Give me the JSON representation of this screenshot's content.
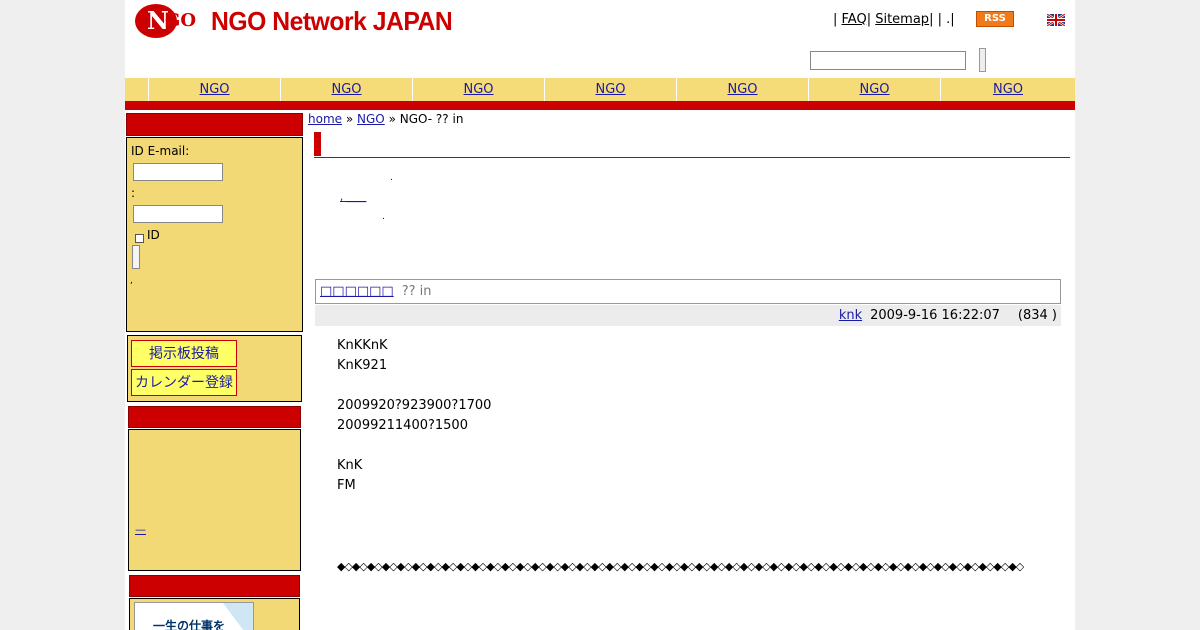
{
  "header": {
    "logo_n": "N",
    "logo_go": "GO",
    "title": "NGO Network JAPAN",
    "links": {
      "sep1": "| ",
      "faq": "FAQ",
      "sep2": "| ",
      "sitemap": "Sitemap",
      "sep3": "| | .|"
    },
    "rss": "RSS",
    "language_flag": "uk-flag-icon"
  },
  "search": {
    "placeholder": "",
    "value": ""
  },
  "nav": {
    "items": [
      "NGO",
      "NGO",
      "NGO",
      "NGO",
      "NGO",
      "NGO",
      "NGO"
    ]
  },
  "sidebar": {
    "login": {
      "id_email_label": "ID  E-mail:",
      "password_label": ":",
      "remember_label": "ID",
      "footnote": ","
    },
    "post_buttons": [
      "掲示板投稿",
      "カレンダー登録"
    ],
    "link_dash": "—",
    "ad_text": "一生の仕事を"
  },
  "breadcrumb": {
    "home": "home",
    "sep1": " » ",
    "ngo": "NGO",
    "sep2": " » ",
    "current": "NGO-  ?? in"
  },
  "intro": {
    "dot1": ".",
    "link": ", ____",
    "dot2": "."
  },
  "forum": {
    "link": "□□□□□□",
    "title": "?? in"
  },
  "meta": {
    "author": "knk",
    "datetime": "2009-9-16 16:22:07",
    "views": "(834 )"
  },
  "post": {
    "lines": [
      "KnKKnK",
      "KnK921",
      "",
      "2009920?923900?1700",
      "20099211400?1500",
      "",
      "KnK",
      "FM"
    ],
    "diamonds": "◆◇◆◇◆◇◆◇◆◇◆◇◆◇◆◇◆◇◆◇◆◇◆◇◆◇◆◇◆◇◆◇◆◇◆◇◆◇◆◇◆◇◆◇◆◇◆◇◆◇◆◇◆◇◆◇◆◇◆◇◆◇◆◇◆◇◆◇◆◇◆◇◆◇◆◇◆◇◆◇◆◇◆◇◆◇◆◇◆◇◆◇"
  },
  "colors": {
    "brand_red": "#cc0000",
    "nav_yellow": "#f6dc78",
    "link_blue": "#1a1aa6",
    "rss_orange": "#f07a1a"
  }
}
